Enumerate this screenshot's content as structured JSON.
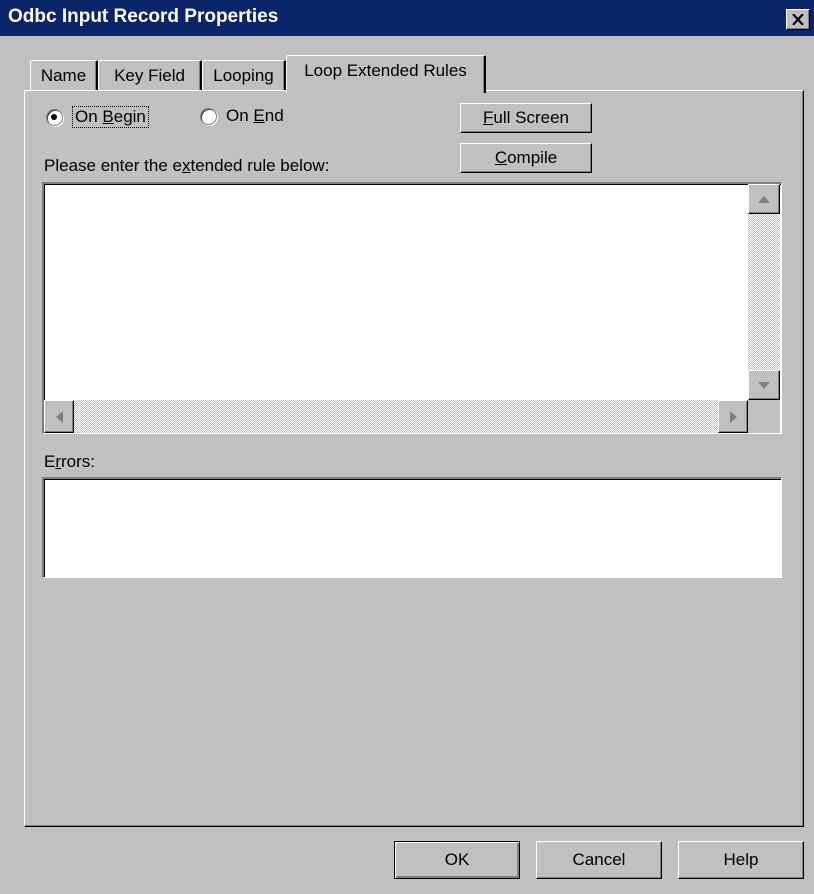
{
  "window": {
    "title": "Odbc Input Record Properties"
  },
  "tabs": [
    {
      "label": "Name",
      "active": false
    },
    {
      "label": "Key Field",
      "active": false
    },
    {
      "label": "Looping",
      "active": false
    },
    {
      "label": "Loop Extended Rules",
      "active": true
    }
  ],
  "rule_timing": {
    "on_begin": {
      "prefix": "On ",
      "mnemonic": "B",
      "suffix": "egin",
      "selected": true
    },
    "on_end": {
      "prefix": "On ",
      "mnemonic": "E",
      "suffix": "nd",
      "selected": false
    }
  },
  "toolbar": {
    "full_screen": {
      "mnemonic": "F",
      "suffix": "ull Screen"
    },
    "compile": {
      "mnemonic": "C",
      "suffix": "ompile"
    }
  },
  "rule_editor": {
    "label_prefix": "Please enter the e",
    "label_mnemonic": "x",
    "label_suffix": "tended rule below:",
    "value": ""
  },
  "errors": {
    "label_prefix": "E",
    "label_mnemonic": "r",
    "label_suffix": "rors:",
    "value": ""
  },
  "footer": {
    "ok_label": "OK",
    "cancel_label": "Cancel",
    "help_label": "Help"
  },
  "icons": {
    "close": "close-icon",
    "scroll_up": "arrow-up-icon",
    "scroll_down": "arrow-down-icon",
    "scroll_left": "arrow-left-icon",
    "scroll_right": "arrow-right-icon"
  }
}
